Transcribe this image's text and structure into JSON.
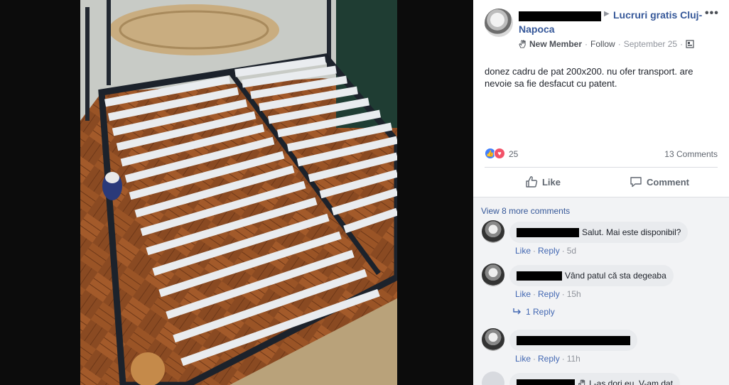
{
  "post": {
    "group_name_line1": "Lucruri gratis Cluj-",
    "group_name_line2": "Napoca",
    "member_badge": "New Member",
    "follow_label": "Follow",
    "date": "September 25",
    "more_label": "•••",
    "text": "donez cadru de pat 200x200. nu ofer transport. are nevoie sa fie desfacut cu patent.",
    "reaction_count": "25",
    "comment_count": "13 Comments",
    "like_label": "Like",
    "comment_label": "Comment"
  },
  "comments": {
    "view_more": "View 8 more comments",
    "like_label": "Like",
    "reply_label": "Reply",
    "separator": "·",
    "items": [
      {
        "text": "Salut. Mai este disponibil?",
        "time": "5d"
      },
      {
        "text": "Vând patul că sta degeaba",
        "time": "15h",
        "replies": "1 Reply"
      },
      {
        "text": "",
        "time": "11h"
      },
      {
        "text": "I -as dori eu. V-am dat"
      }
    ]
  },
  "colors": {
    "link_blue": "#365899",
    "action_blue": "#4267b2",
    "like_blue": "#4080ff",
    "love_red": "#f25268",
    "comment_bg": "#f2f3f5"
  },
  "icons": [
    "hand-wave-icon",
    "globe-icon",
    "like-reaction-icon",
    "love-reaction-icon",
    "thumbs-up-icon",
    "comment-icon",
    "reply-arrow-icon"
  ]
}
